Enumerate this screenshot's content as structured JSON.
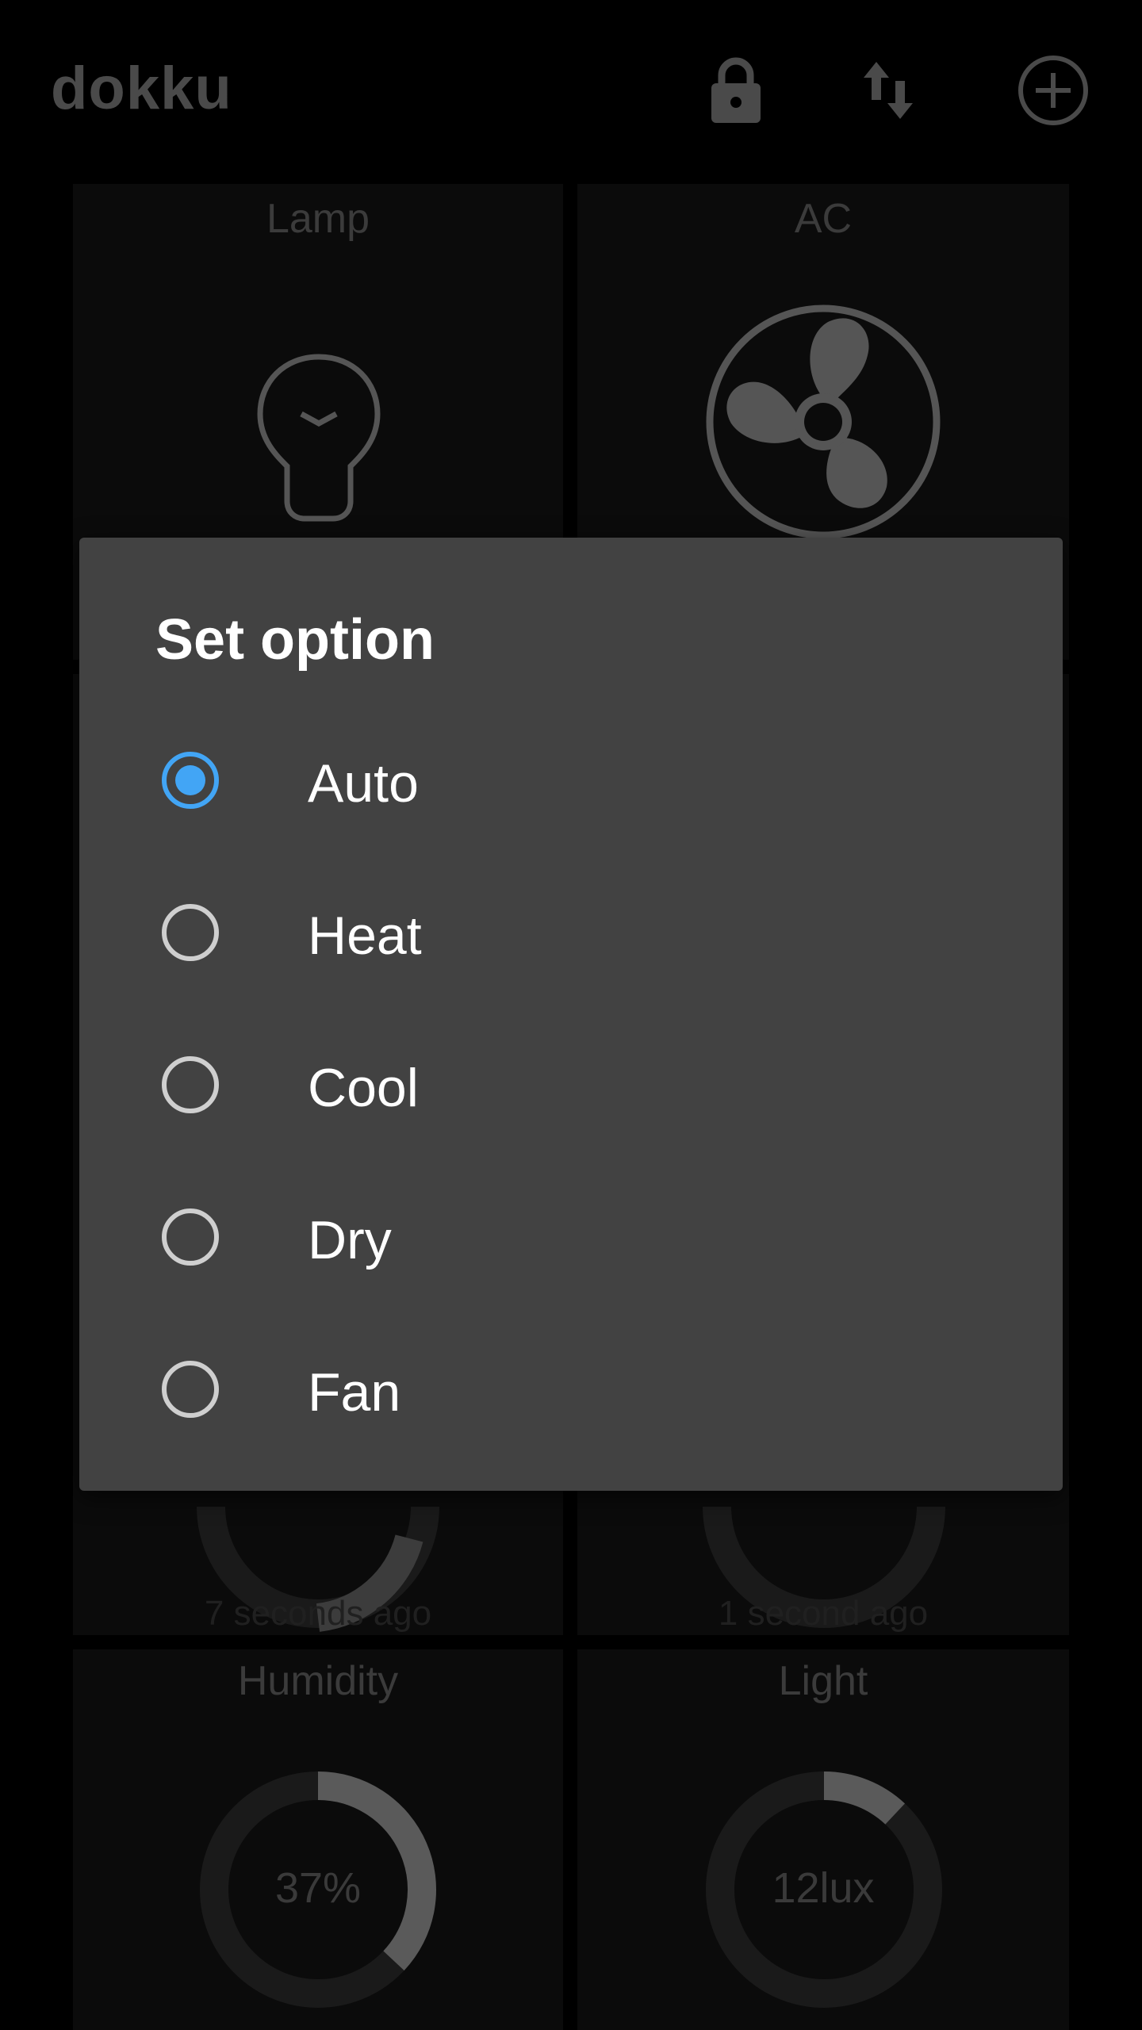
{
  "app": {
    "title": "dokku",
    "icons": {
      "lock": "lock-icon",
      "sort": "swap-vertical-icon",
      "add": "add-circle-icon"
    }
  },
  "widgets": [
    {
      "title": "Lamp",
      "icon": "lightbulb-icon"
    },
    {
      "title": "AC",
      "icon": "fan-icon"
    },
    {
      "foot": "7 seconds ago"
    },
    {
      "foot": "1 second ago"
    },
    {
      "title": "Humidity",
      "value_text": "37%",
      "fraction": 0.37
    },
    {
      "title": "Light",
      "value_text": "12lux",
      "fraction": 0.12
    }
  ],
  "dialog": {
    "title": "Set option",
    "selected": "Auto",
    "options": [
      {
        "label": "Auto",
        "checked": true
      },
      {
        "label": "Heat",
        "checked": false
      },
      {
        "label": "Cool",
        "checked": false
      },
      {
        "label": "Dry",
        "checked": false
      },
      {
        "label": "Fan",
        "checked": false
      }
    ]
  },
  "colors": {
    "accent": "#42a5f5",
    "dialog_bg": "#424242",
    "background": "#000000",
    "tile_bg": "#0b0b0b"
  }
}
